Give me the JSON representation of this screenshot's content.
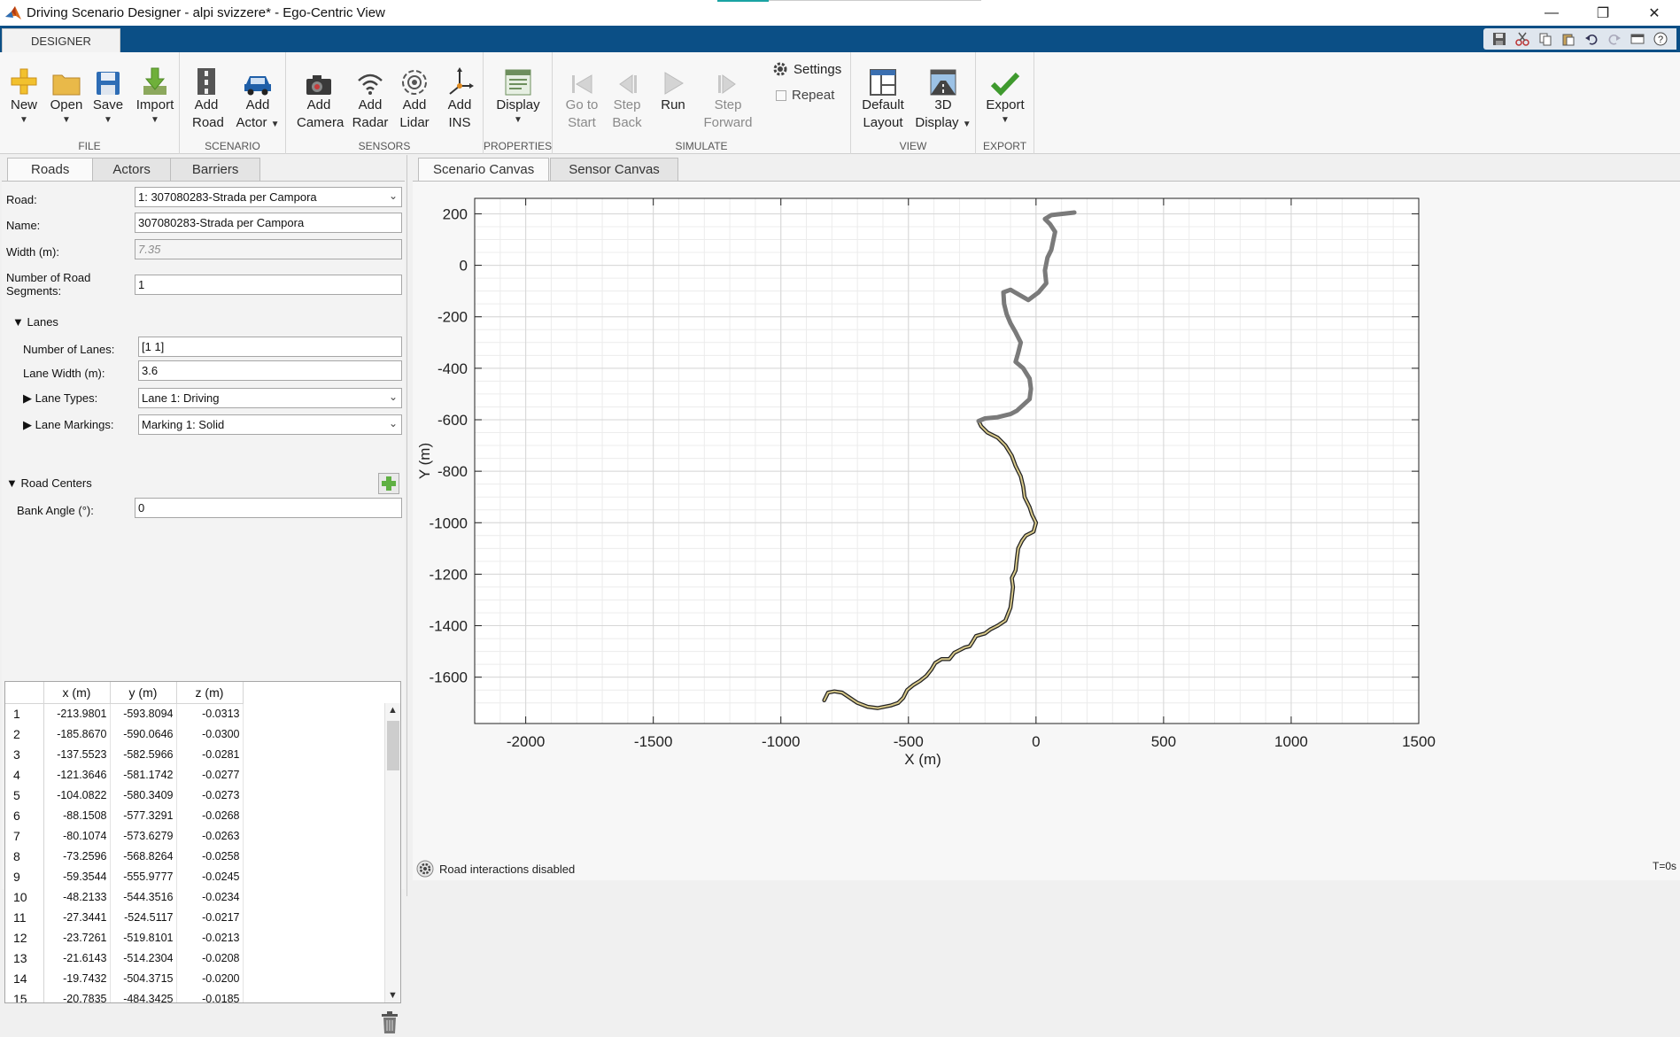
{
  "window": {
    "title": "Driving Scenario Designer - alpi svizzere* - Ego-Centric View",
    "controls": [
      "minimize",
      "maximize",
      "close"
    ]
  },
  "ribbon_tab": "DESIGNER",
  "ribbon": {
    "file": {
      "label": "FILE",
      "new": "New",
      "open": "Open",
      "save": "Save",
      "import": "Import"
    },
    "scenario": {
      "label": "SCENARIO",
      "add_road_1": "Add",
      "add_road_2": "Road",
      "add_actor_1": "Add",
      "add_actor_2": "Actor"
    },
    "sensors": {
      "label": "SENSORS",
      "camera_1": "Add",
      "camera_2": "Camera",
      "radar_1": "Add",
      "radar_2": "Radar",
      "lidar_1": "Add",
      "lidar_2": "Lidar",
      "ins_1": "Add",
      "ins_2": "INS"
    },
    "properties": {
      "label": "PROPERTIES",
      "display": "Display"
    },
    "simulate": {
      "label": "SIMULATE",
      "goto_1": "Go to",
      "goto_2": "Start",
      "stepback_1": "Step",
      "stepback_2": "Back",
      "run": "Run",
      "stepfwd_1": "Step",
      "stepfwd_2": "Forward",
      "settings": "Settings",
      "repeat": "Repeat"
    },
    "view": {
      "label": "VIEW",
      "default_1": "Default",
      "default_2": "Layout",
      "display3d_1": "3D",
      "display3d_2": "Display"
    },
    "export": {
      "label": "EXPORT",
      "export": "Export"
    }
  },
  "left_tabs": [
    "Roads",
    "Actors",
    "Barriers"
  ],
  "road_form": {
    "road_label": "Road:",
    "road_value": "1: 307080283-Strada per Campora",
    "name_label": "Name:",
    "name_value": "307080283-Strada per Campora",
    "width_label": "Width (m):",
    "width_value": "7.35",
    "segments_label_1": "Number of Road",
    "segments_label_2": "Segments:",
    "segments_value": "1",
    "lanes_section": "Lanes",
    "num_lanes_label": "Number of Lanes:",
    "num_lanes_value": "[1 1]",
    "lane_width_label": "Lane Width (m):",
    "lane_width_value": "3.6",
    "lane_types_label": "Lane Types:",
    "lane_types_value": "Lane 1: Driving",
    "lane_markings_label": "Lane Markings:",
    "lane_markings_value": "Marking 1: Solid",
    "road_centers_section": "Road Centers",
    "bank_angle_label": "Bank Angle (°):",
    "bank_angle_value": "0"
  },
  "road_centers_table": {
    "columns": [
      "x (m)",
      "y (m)",
      "z (m)"
    ],
    "rows": [
      [
        "1",
        "-213.9801",
        "-593.8094",
        "-0.0313"
      ],
      [
        "2",
        "-185.8670",
        "-590.0646",
        "-0.0300"
      ],
      [
        "3",
        "-137.5523",
        "-582.5966",
        "-0.0281"
      ],
      [
        "4",
        "-121.3646",
        "-581.1742",
        "-0.0277"
      ],
      [
        "5",
        "-104.0822",
        "-580.3409",
        "-0.0273"
      ],
      [
        "6",
        "-88.1508",
        "-577.3291",
        "-0.0268"
      ],
      [
        "7",
        "-80.1074",
        "-573.6279",
        "-0.0263"
      ],
      [
        "8",
        "-73.2596",
        "-568.8264",
        "-0.0258"
      ],
      [
        "9",
        "-59.3544",
        "-555.9777",
        "-0.0245"
      ],
      [
        "10",
        "-48.2133",
        "-544.3516",
        "-0.0234"
      ],
      [
        "11",
        "-27.3441",
        "-524.5117",
        "-0.0217"
      ],
      [
        "12",
        "-23.7261",
        "-519.8101",
        "-0.0213"
      ],
      [
        "13",
        "-21.6143",
        "-514.2304",
        "-0.0208"
      ],
      [
        "14",
        "-19.7432",
        "-504.3715",
        "-0.0200"
      ],
      [
        "15",
        "-20.7835",
        "-484.3425",
        "-0.0185"
      ]
    ]
  },
  "canvas_tabs": [
    "Scenario Canvas",
    "Sensor Canvas"
  ],
  "status": {
    "text": "Road interactions disabled",
    "time": "T=0s"
  },
  "chart_data": {
    "type": "line",
    "xlabel": "X (m)",
    "ylabel": "Y (m)",
    "xlim": [
      -2200,
      1500
    ],
    "ylim": [
      -1780,
      260
    ],
    "xticks": [
      -2000,
      -1500,
      -1000,
      -500,
      0,
      500,
      1000,
      1500
    ],
    "yticks": [
      200,
      0,
      -200,
      -400,
      -600,
      -800,
      -1000,
      -1200,
      -1400,
      -1600
    ],
    "grid": true,
    "series": [
      {
        "role": "selected road",
        "color": "#222222",
        "fill": "#d8c98a",
        "points": [
          [
            -830,
            -1690
          ],
          [
            -815,
            -1660
          ],
          [
            -790,
            -1655
          ],
          [
            -760,
            -1660
          ],
          [
            -730,
            -1680
          ],
          [
            -700,
            -1700
          ],
          [
            -660,
            -1715
          ],
          [
            -620,
            -1720
          ],
          [
            -570,
            -1710
          ],
          [
            -540,
            -1700
          ],
          [
            -520,
            -1680
          ],
          [
            -505,
            -1650
          ],
          [
            -480,
            -1630
          ],
          [
            -455,
            -1615
          ],
          [
            -430,
            -1595
          ],
          [
            -410,
            -1570
          ],
          [
            -395,
            -1545
          ],
          [
            -370,
            -1530
          ],
          [
            -340,
            -1530
          ],
          [
            -320,
            -1505
          ],
          [
            -300,
            -1495
          ],
          [
            -280,
            -1485
          ],
          [
            -260,
            -1480
          ],
          [
            -250,
            -1465
          ],
          [
            -235,
            -1440
          ],
          [
            -200,
            -1430
          ],
          [
            -180,
            -1415
          ],
          [
            -150,
            -1400
          ],
          [
            -120,
            -1380
          ],
          [
            -100,
            -1330
          ],
          [
            -95,
            -1290
          ],
          [
            -90,
            -1250
          ],
          [
            -95,
            -1215
          ],
          [
            -80,
            -1185
          ],
          [
            -75,
            -1140
          ],
          [
            -70,
            -1100
          ],
          [
            -55,
            -1070
          ],
          [
            -40,
            -1050
          ],
          [
            -10,
            -1035
          ],
          [
            0,
            -1000
          ],
          [
            -15,
            -970
          ],
          [
            -25,
            -940
          ],
          [
            -45,
            -900
          ],
          [
            -50,
            -860
          ],
          [
            -60,
            -820
          ],
          [
            -80,
            -780
          ],
          [
            -95,
            -740
          ],
          [
            -120,
            -700
          ],
          [
            -150,
            -670
          ],
          [
            -190,
            -650
          ],
          [
            -215,
            -625
          ],
          [
            -225,
            -605
          ]
        ]
      },
      {
        "role": "other road",
        "color": "#7a7a7a",
        "points": [
          [
            -225,
            -605
          ],
          [
            -200,
            -595
          ],
          [
            -150,
            -590
          ],
          [
            -100,
            -578
          ],
          [
            -75,
            -565
          ],
          [
            -25,
            -520
          ],
          [
            -20,
            -480
          ],
          [
            -25,
            -440
          ],
          [
            -50,
            -400
          ],
          [
            -80,
            -375
          ],
          [
            -70,
            -340
          ],
          [
            -60,
            -300
          ],
          [
            -80,
            -260
          ],
          [
            -100,
            -225
          ],
          [
            -115,
            -190
          ],
          [
            -125,
            -150
          ],
          [
            -128,
            -105
          ],
          [
            -100,
            -95
          ],
          [
            -30,
            -135
          ],
          [
            10,
            -105
          ],
          [
            40,
            -70
          ],
          [
            35,
            -20
          ],
          [
            45,
            30
          ],
          [
            60,
            60
          ],
          [
            75,
            130
          ],
          [
            55,
            160
          ],
          [
            35,
            180
          ],
          [
            60,
            195
          ],
          [
            150,
            205
          ]
        ]
      }
    ]
  }
}
